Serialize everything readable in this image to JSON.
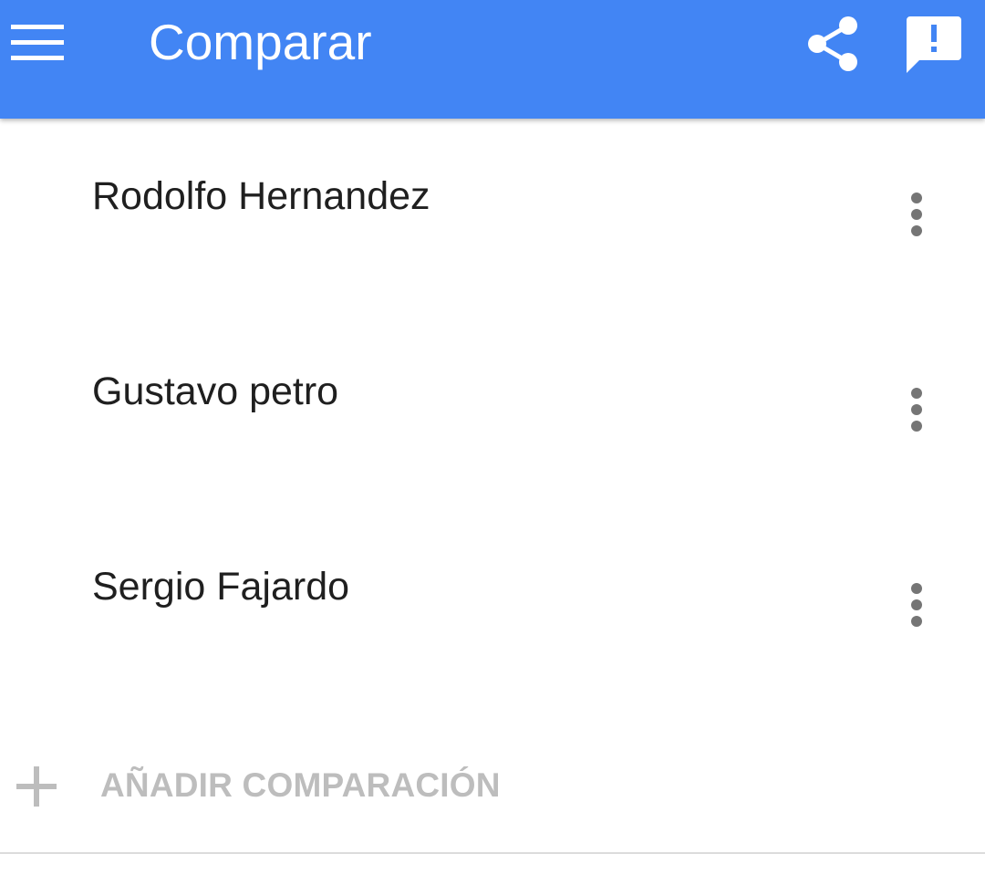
{
  "toolbar": {
    "title": "Comparar",
    "background_color": "#4285f4",
    "menu_icon": "hamburger-menu-icon",
    "share_icon": "share-icon",
    "feedback_icon": "feedback-icon"
  },
  "comparisons": [
    {
      "label": "Rodolfo Hernandez",
      "menu_icon": "more-vert-icon"
    },
    {
      "label": "Gustavo petro",
      "menu_icon": "more-vert-icon"
    },
    {
      "label": "Sergio Fajardo",
      "menu_icon": "more-vert-icon"
    }
  ],
  "add_comparison": {
    "label": "AÑADIR COMPARACIÓN",
    "icon": "plus-icon",
    "color": "#bdbdbd"
  }
}
